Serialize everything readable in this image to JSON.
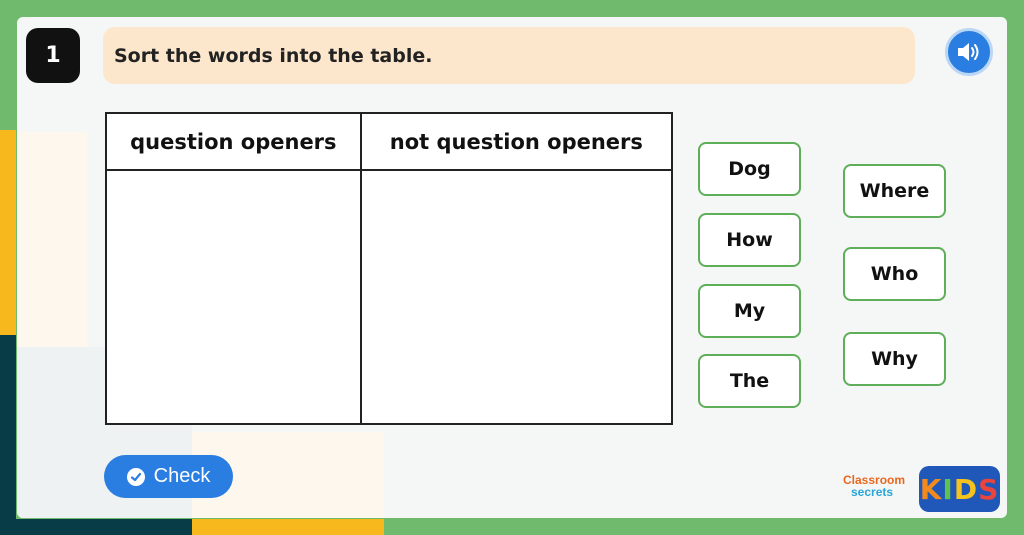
{
  "question": {
    "number": "1",
    "instruction": "Sort the words into the table."
  },
  "audio": {
    "icon": "speaker-icon"
  },
  "table": {
    "headers": [
      "question openers",
      "not question openers"
    ]
  },
  "word_tiles": {
    "column_1": [
      "Dog",
      "How",
      "My",
      "The"
    ],
    "column_2": [
      "Where",
      "Who",
      "Why"
    ]
  },
  "check_button": {
    "label": "Check",
    "icon": "check-circle-icon"
  },
  "branding": {
    "classroom_secrets": [
      "Classroom",
      "secrets"
    ],
    "kids_letters": [
      "K",
      "I",
      "D",
      "S"
    ]
  },
  "colors": {
    "page_green": "#6fba6c",
    "instruction_bg": "#fde7cc",
    "tile_border": "#5fae5a",
    "button_blue": "#2a7de1"
  }
}
